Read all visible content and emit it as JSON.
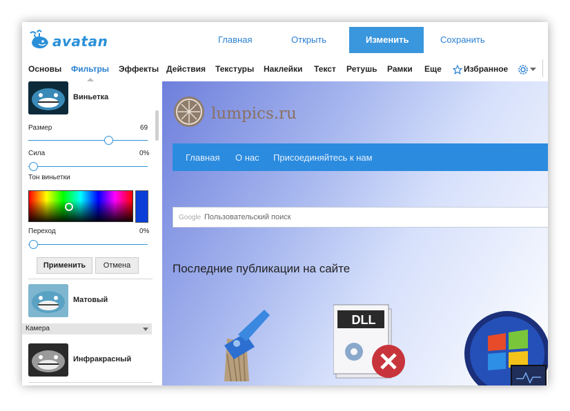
{
  "app": {
    "logo_text": "avatan"
  },
  "top_nav": [
    {
      "label": "Главная"
    },
    {
      "label": "Открыть"
    },
    {
      "label": "Изменить",
      "active": true
    },
    {
      "label": "Сохранить"
    }
  ],
  "menu": [
    {
      "label": "Основы"
    },
    {
      "label": "Фильтры",
      "active": true
    },
    {
      "label": "Эффекты"
    },
    {
      "label": "Действия"
    },
    {
      "label": "Текстуры"
    },
    {
      "label": "Наклейки"
    },
    {
      "label": "Текст"
    },
    {
      "label": "Ретушь"
    },
    {
      "label": "Рамки"
    },
    {
      "label": "Еще"
    },
    {
      "label": "Избранное"
    }
  ],
  "sidebar": {
    "vignette": {
      "name": "Виньетка",
      "size_label": "Размер",
      "size_value": "69",
      "size_level": 0.69,
      "strength_label": "Сила",
      "strength_value": "0%",
      "strength_level": 0,
      "tone_label": "Тон виньетки",
      "tone_color": "#0a3ed8",
      "transition_label": "Переход",
      "transition_value": "0%",
      "transition_level": 0,
      "apply_label": "Применить",
      "cancel_label": "Отмена"
    },
    "matte": {
      "name": "Матовый"
    },
    "camera": {
      "label": "Камера"
    },
    "infrared": {
      "name": "Инфракрасный"
    }
  },
  "canvas": {
    "site_title": "lumpics.ru",
    "site_nav": [
      "Главная",
      "О нас",
      "Присоединяйтесь к нам"
    ],
    "search_brand": "Google",
    "search_placeholder": "Пользовательский поиск",
    "heading": "Последние публикации на сайте",
    "dll_label": "DLL"
  },
  "colors": {
    "accent": "#2a90d8",
    "nav_active": "#3a96dd",
    "site_nav": "#2b8bdf"
  }
}
